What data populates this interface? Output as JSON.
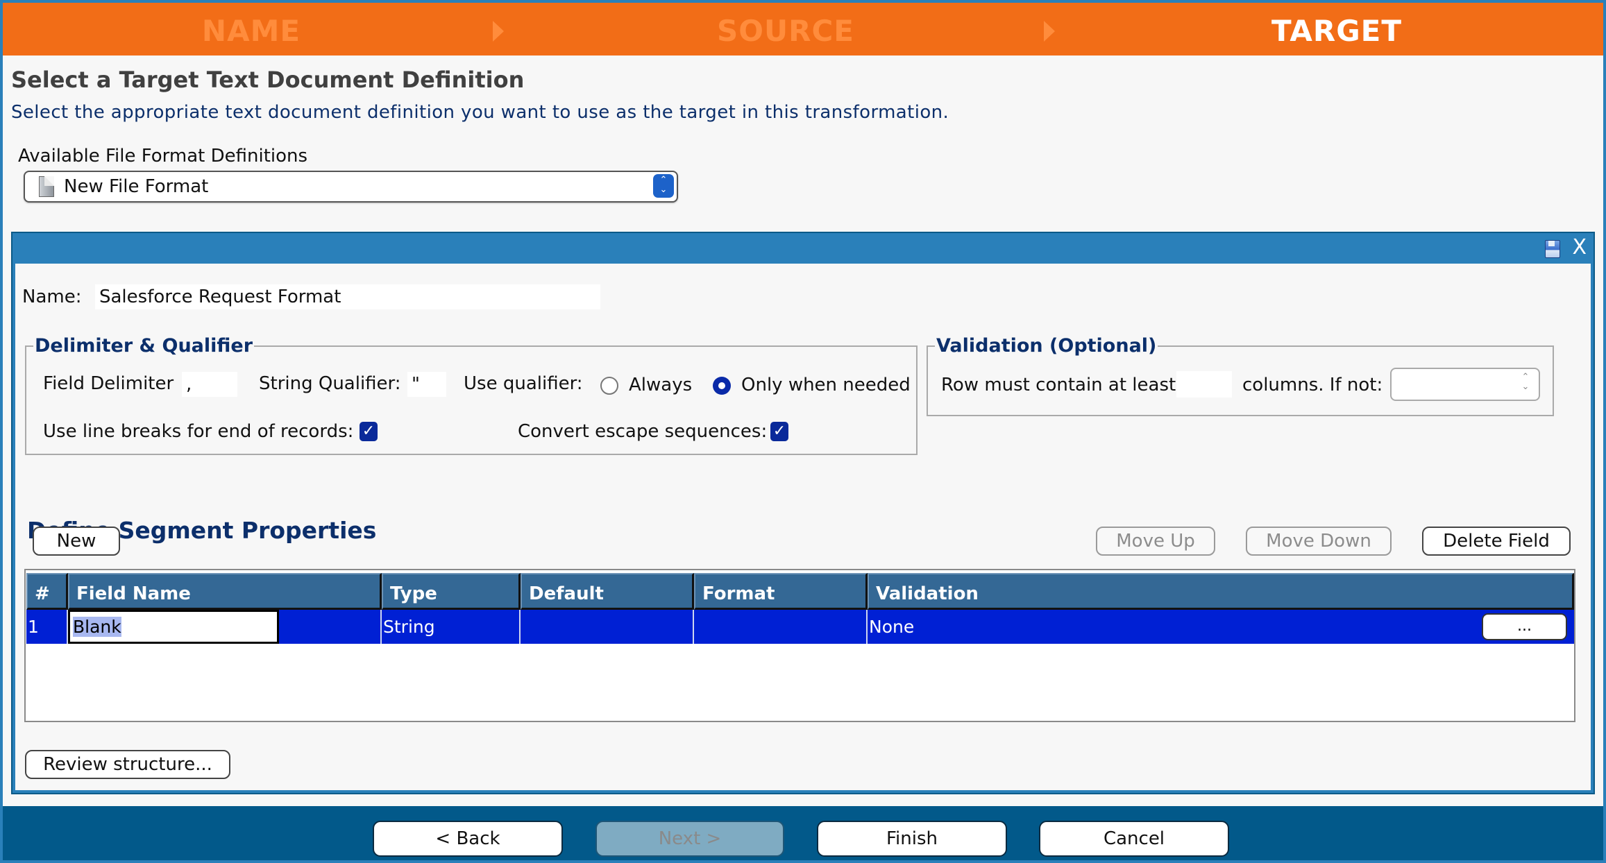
{
  "wizard": {
    "steps": [
      {
        "label": "NAME",
        "state": "inactive"
      },
      {
        "label": "SOURCE",
        "state": "inactive"
      },
      {
        "label": "TARGET",
        "state": "active"
      }
    ]
  },
  "header": {
    "title": "Select a Target Text Document Definition",
    "subtitle": "Select the appropriate text document definition you want to use as the target in this transformation."
  },
  "format_select": {
    "label": "Available File Format Definitions",
    "selected": "New File Format",
    "icon": "document-icon"
  },
  "panel": {
    "icons": [
      "save-icon",
      "close-icon"
    ],
    "close_glyph": "X",
    "name_label": "Name:",
    "name_value": "Salesforce Request Format",
    "delimiter_group": {
      "legend": "Delimiter & Qualifier",
      "field_delimiter_label": "Field Delimiter",
      "field_delimiter_value": ",",
      "string_qualifier_label": "String Qualifier:",
      "string_qualifier_value": "\"",
      "use_qualifier_label": "Use qualifier:",
      "qualifier_options": [
        {
          "label": "Always",
          "selected": false
        },
        {
          "label": "Only when needed",
          "selected": true
        }
      ],
      "line_breaks_label": "Use line breaks for end of records:",
      "line_breaks_checked": true,
      "escape_label": "Convert escape sequences:",
      "escape_checked": true
    },
    "validation_group": {
      "legend": "Validation (Optional)",
      "row_min_label": "Row must contain at least",
      "row_min_value": "",
      "if_not_label": "columns. If not:",
      "if_not_value": ""
    },
    "segment": {
      "title": "Define Segment Properties",
      "buttons": {
        "new": "New",
        "move_up": "Move Up",
        "move_down": "Move Down",
        "delete_field": "Delete Field"
      },
      "columns": [
        "#",
        "Field Name",
        "Type",
        "Default",
        "Format",
        "Validation"
      ],
      "rows": [
        {
          "num": "1",
          "field_name": "Blank",
          "type": "String",
          "default": "",
          "format": "",
          "validation": "None",
          "action": "..."
        }
      ],
      "review_button": "Review structure..."
    }
  },
  "footer": {
    "back": "< Back",
    "next": "Next >",
    "finish": "Finish",
    "cancel": "Cancel"
  },
  "colors": {
    "step_bar": "#f26d17",
    "panel_header": "#2a80ba",
    "footer": "#02598a",
    "selected_row": "#0020d4",
    "table_header": "#346895"
  }
}
